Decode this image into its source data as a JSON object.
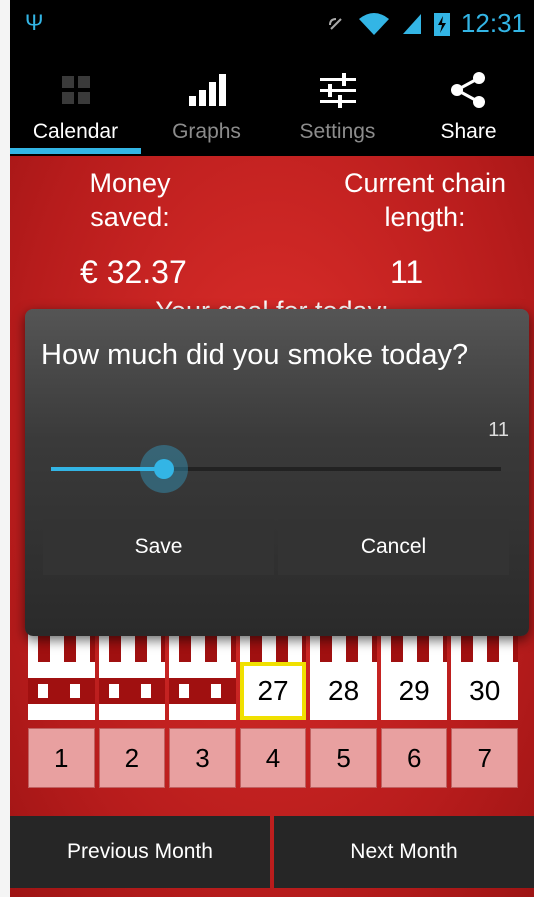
{
  "colors": {
    "accent": "#33b5e5",
    "background_red": "#c62828",
    "today_outline": "#f0e000"
  },
  "status": {
    "time": "12:31"
  },
  "tabs": [
    {
      "label": "Calendar",
      "icon": "grid-icon"
    },
    {
      "label": "Graphs",
      "icon": "bar-graph-icon"
    },
    {
      "label": "Settings",
      "icon": "sliders-icon"
    },
    {
      "label": "Share",
      "icon": "share-icon"
    }
  ],
  "stats": {
    "money_label": "Money saved:",
    "money_value": "€ 32.37",
    "chain_label": "Current chain length:",
    "chain_value": "11",
    "goal_label": "Your goal for today:"
  },
  "dialog": {
    "title": "How much did you smoke today?",
    "value": "11",
    "slider_fraction": 0.25,
    "save_label": "Save",
    "cancel_label": "Cancel"
  },
  "calendar": {
    "week_end_days": [
      "27",
      "28",
      "29",
      "30"
    ],
    "next_week_days": [
      "1",
      "2",
      "3",
      "4",
      "5",
      "6",
      "7"
    ]
  },
  "nav": {
    "prev_label": "Previous Month",
    "next_label": "Next Month"
  }
}
